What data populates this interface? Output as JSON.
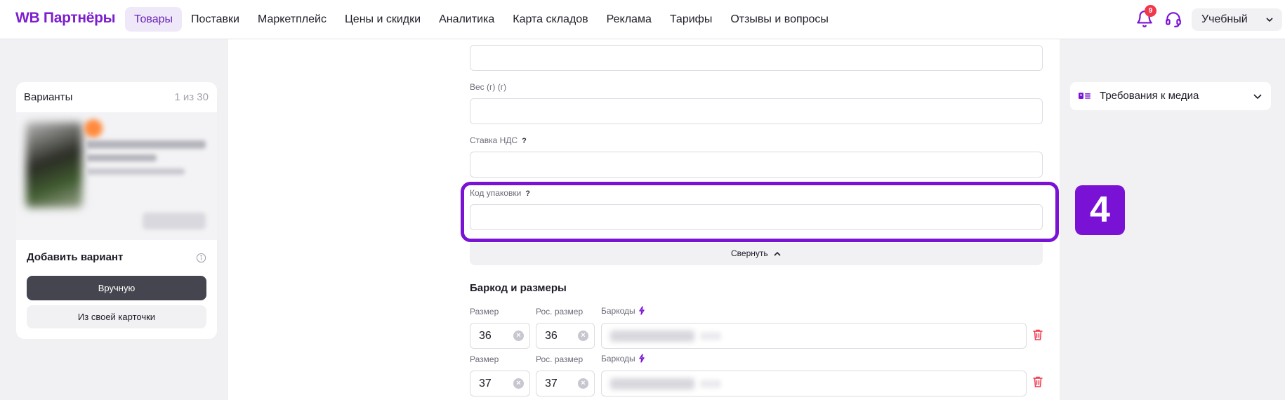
{
  "header": {
    "logo": "WB Партнёры",
    "nav": [
      "Товары",
      "Поставки",
      "Маркетплейс",
      "Цены и скидки",
      "Аналитика",
      "Карта складов",
      "Реклама",
      "Тарифы",
      "Отзывы и вопросы"
    ],
    "active_nav": "Товары",
    "notifications_count": "9",
    "account_label": "Учебный",
    "icons": [
      "bell-icon",
      "headset-icon",
      "chevron-down-icon"
    ]
  },
  "variants": {
    "title": "Варианты",
    "count": "1 из 30",
    "add_title": "Добавить вариант",
    "manual_button": "Вручную",
    "own_card_button": "Из своей карточки"
  },
  "form": {
    "weight_label": "Вес (г) (г)",
    "vat_label": "Ставка НДС",
    "package_code_label": "Код упаковки",
    "help_mark": "?",
    "collapse_label": "Свернуть",
    "barcode_section_title": "Баркод и размеры",
    "size_rows": [
      {
        "size_label": "Размер",
        "ru_size_label": "Рос. размер",
        "barcodes_label": "Баркоды",
        "size": "36",
        "ru_size": "36"
      },
      {
        "size_label": "Размер",
        "ru_size_label": "Рос. размер",
        "barcodes_label": "Баркоды",
        "size": "37",
        "ru_size": "37"
      }
    ]
  },
  "step_badge": "4",
  "media_requirements": {
    "label": "Требования к медиа"
  },
  "colors": {
    "accent": "#7a12d6",
    "logo": "#7d1ecf",
    "badge": "#f0384b",
    "trash": "#f0384b"
  }
}
